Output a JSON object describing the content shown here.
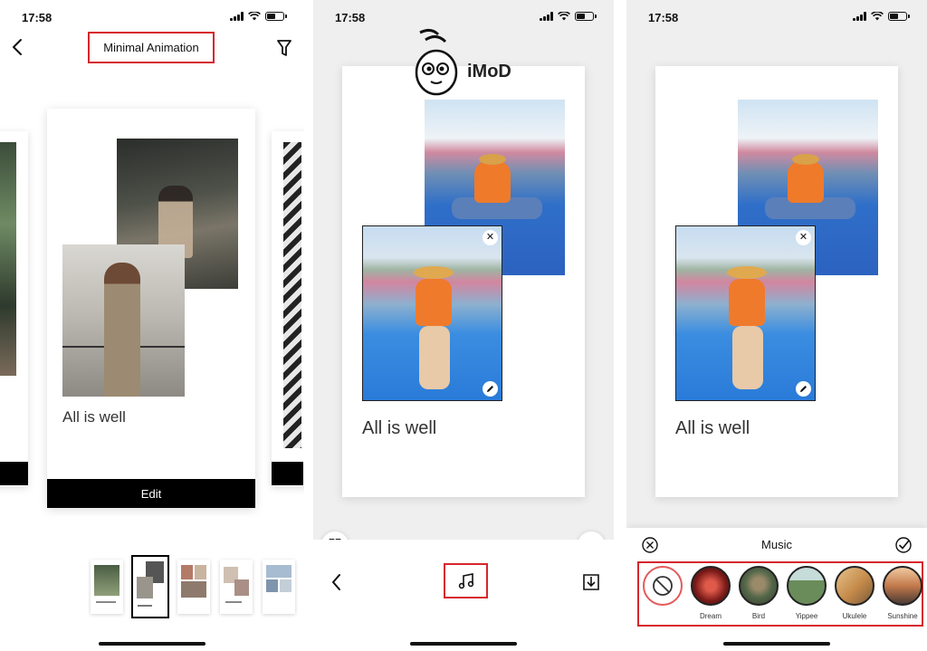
{
  "status": {
    "time": "17:58"
  },
  "screen1": {
    "title": "Minimal Animation",
    "card_caption": "All is well",
    "edit_label": "Edit",
    "thumbnails": [
      "Template 1",
      "Template 2",
      "Template 3",
      "Template 4",
      "Template 5"
    ],
    "selected_thumbnail": 2
  },
  "screen2": {
    "canvas_caption": "All is well",
    "watermark": "iMoD"
  },
  "screen3": {
    "canvas_caption": "All is well",
    "sheet_title": "Music",
    "tracks": [
      {
        "label": "",
        "icon": "no-music-icon",
        "color": "#ffffff"
      },
      {
        "label": "Dream",
        "icon": "dream-artwork",
        "color": "#b9352f"
      },
      {
        "label": "Bird",
        "icon": "bird-artwork",
        "color": "#55684a"
      },
      {
        "label": "Yippee",
        "icon": "yippee-artwork",
        "color": "#6a8c5a"
      },
      {
        "label": "Ukulele",
        "icon": "ukulele-artwork",
        "color": "#c48a4a"
      },
      {
        "label": "Sunshine",
        "icon": "sunshine-artwork",
        "color": "#c2794b"
      }
    ]
  },
  "colors": {
    "highlight": "#d7262c",
    "button": "#000000",
    "canvas_bg": "#efefef"
  }
}
